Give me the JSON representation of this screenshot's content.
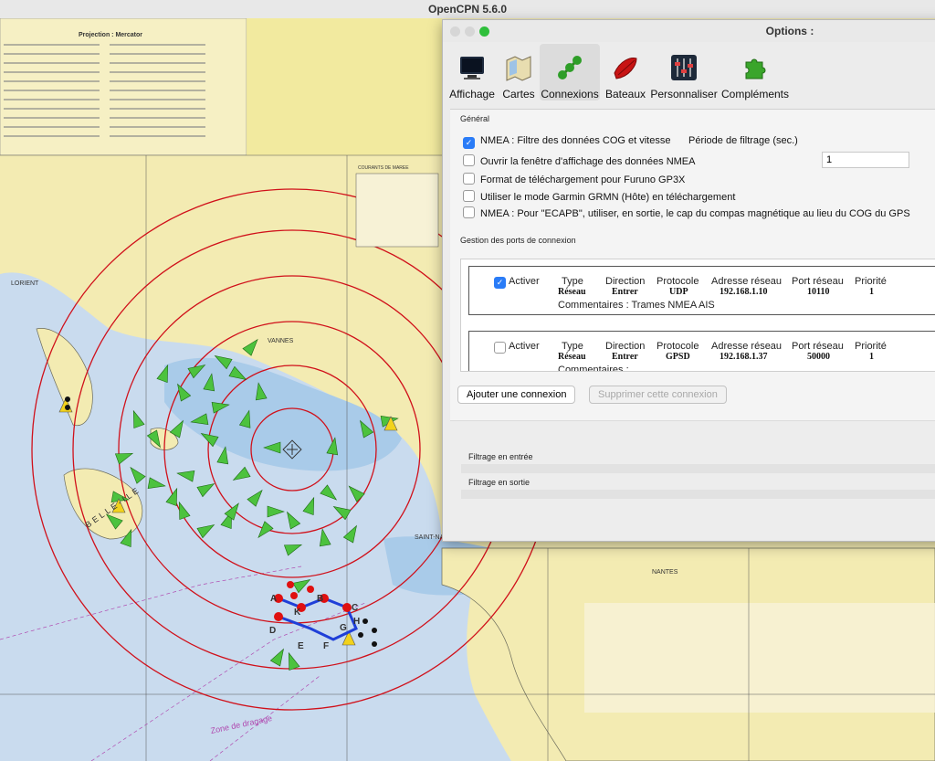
{
  "app": {
    "title": "OpenCPN 5.6.0"
  },
  "chart": {
    "projection_label": "Projection : Mercator",
    "labels": [
      "LORIENT",
      "VANNES",
      "SAINT-NAZAIRE",
      "NANTES",
      "BELLE-ILE"
    ],
    "waypoints": [
      "A",
      "B",
      "C",
      "D",
      "E",
      "F",
      "G",
      "H",
      "K"
    ],
    "legend_heading": "COURANTS DE MAREE",
    "notes_heading": "Zone de dragage",
    "colors": {
      "sea": "#c8d9ec",
      "shallow": "#9ec3e6",
      "land": "#f3ebb2",
      "range_ring": "#d0101a",
      "ais": "#3fc23a"
    }
  },
  "dialog": {
    "title": "Options :",
    "toolbar": [
      {
        "label": "Affichage",
        "icon": "monitor-icon"
      },
      {
        "label": "Cartes",
        "icon": "charts-icon"
      },
      {
        "label": "Connexions",
        "icon": "connections-icon"
      },
      {
        "label": "Bateaux",
        "icon": "boat-icon"
      },
      {
        "label": "Personnaliser",
        "icon": "sliders-icon"
      },
      {
        "label": "Compléments",
        "icon": "puzzle-icon"
      }
    ],
    "general": {
      "heading": "Général",
      "nmea_filter": "NMEA : Filtre des données COG et vitesse",
      "filter_period_label": "Période de filtrage (sec.)",
      "filter_period_value": "1",
      "options": [
        "Ouvrir la fenêtre d'affichage des données NMEA",
        "Format de téléchargement pour Furuno GP3X",
        "Utiliser le mode Garmin GRMN (Hôte) en téléchargement",
        "NMEA : Pour \"ECAPB\", utiliser, en sortie, le cap du compas magnétique  au lieu du COG du GPS"
      ]
    },
    "ports": {
      "heading": "Gestion des ports de connexion",
      "headers": {
        "enable": "Activer",
        "type": "Type",
        "direction": "Direction",
        "protocol": "Protocole",
        "address": "Adresse réseau",
        "port": "Port réseau",
        "priority": "Priorité"
      },
      "connections": [
        {
          "enabled": true,
          "type": "Réseau",
          "direction": "Entrer",
          "protocol": "UDP",
          "address": "192.168.1.10",
          "port": "10110",
          "priority": "1",
          "comment": "Commentaires : Trames NMEA AIS"
        },
        {
          "enabled": false,
          "type": "Réseau",
          "direction": "Entrer",
          "protocol": "GPSD",
          "address": "192.168.1.37",
          "port": "50000",
          "priority": "1",
          "comment": "Commentaires :"
        }
      ],
      "add_button": "Ajouter une connexion",
      "remove_button": "Supprimer cette connexion"
    },
    "filters": {
      "input": "Filtrage en entrée",
      "output": "Filtrage en sortie"
    }
  }
}
